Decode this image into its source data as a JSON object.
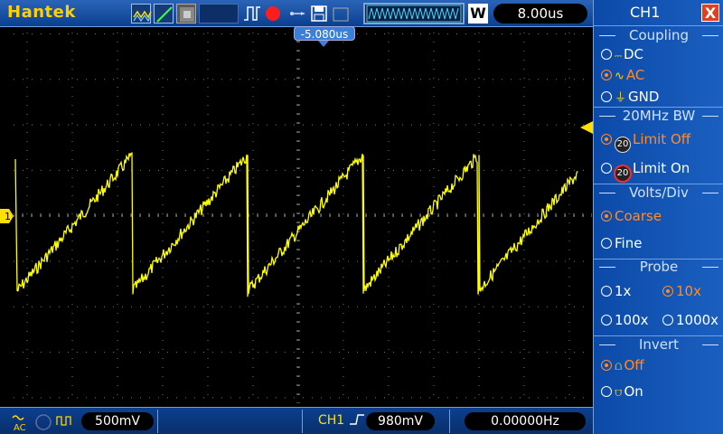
{
  "brand": "Hantek",
  "timebase": "8.00us",
  "trigger_position": "-5.080us",
  "window_label": "W",
  "channel_marker": "1",
  "bottom": {
    "coupling_icon": "AC",
    "ch1_volts": "500mV",
    "trigger_source": "CH1",
    "trigger_level": "980mV",
    "frequency": "0.00000Hz"
  },
  "panel": {
    "title": "CH1",
    "close": "X",
    "coupling": {
      "title": "Coupling",
      "options": [
        {
          "label": "DC",
          "icon": "dc-icon",
          "selected": false
        },
        {
          "label": "AC",
          "icon": "ac-icon",
          "selected": true
        },
        {
          "label": "GND",
          "icon": "gnd-icon",
          "selected": false
        }
      ]
    },
    "bw": {
      "title": "20MHz BW",
      "limit_off": "Limit Off",
      "limit_on": "Limit On",
      "badge": "20"
    },
    "volts": {
      "title": "Volts/Div",
      "coarse": "Coarse",
      "fine": "Fine"
    },
    "probe": {
      "title": "Probe",
      "x1": "1x",
      "x10": "10x",
      "x100": "100x",
      "x1000": "1000x"
    },
    "invert": {
      "title": "Invert",
      "off": "Off",
      "on": "On"
    }
  },
  "colors": {
    "trace": "#ffff00",
    "accent": "#ff8c2a",
    "panel": "#0c4aa8"
  },
  "waveform": {
    "type": "sawtooth",
    "period_divisions": 2.5,
    "peak_divisions_above_center": 1.4,
    "trough_divisions_below_center": 1.6
  }
}
